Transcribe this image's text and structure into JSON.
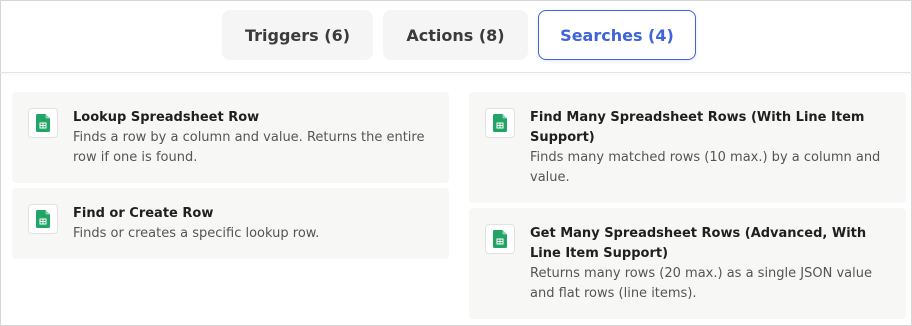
{
  "tabs": [
    {
      "label": "Triggers (6)"
    },
    {
      "label": "Actions (8)"
    },
    {
      "label": "Searches (4)"
    }
  ],
  "colors": {
    "accent": "#3f63d8",
    "sheets_green": "#21a464"
  },
  "cards": [
    {
      "title": "Lookup Spreadsheet Row",
      "description": "Finds a row by a column and value. Returns the entire row if one is found.",
      "icon": "google-sheets-icon"
    },
    {
      "title": "Find or Create Row",
      "description": "Finds or creates a specific lookup row.",
      "icon": "google-sheets-icon"
    },
    {
      "title": "Find Many Spreadsheet Rows (With Line Item Support)",
      "description": "Finds many matched rows (10 max.) by a column and value.",
      "icon": "google-sheets-icon"
    },
    {
      "title": "Get Many Spreadsheet Rows (Advanced, With Line Item Support)",
      "description": "Returns many rows (20 max.) as a single JSON value and flat rows (line items).",
      "icon": "google-sheets-icon"
    }
  ]
}
